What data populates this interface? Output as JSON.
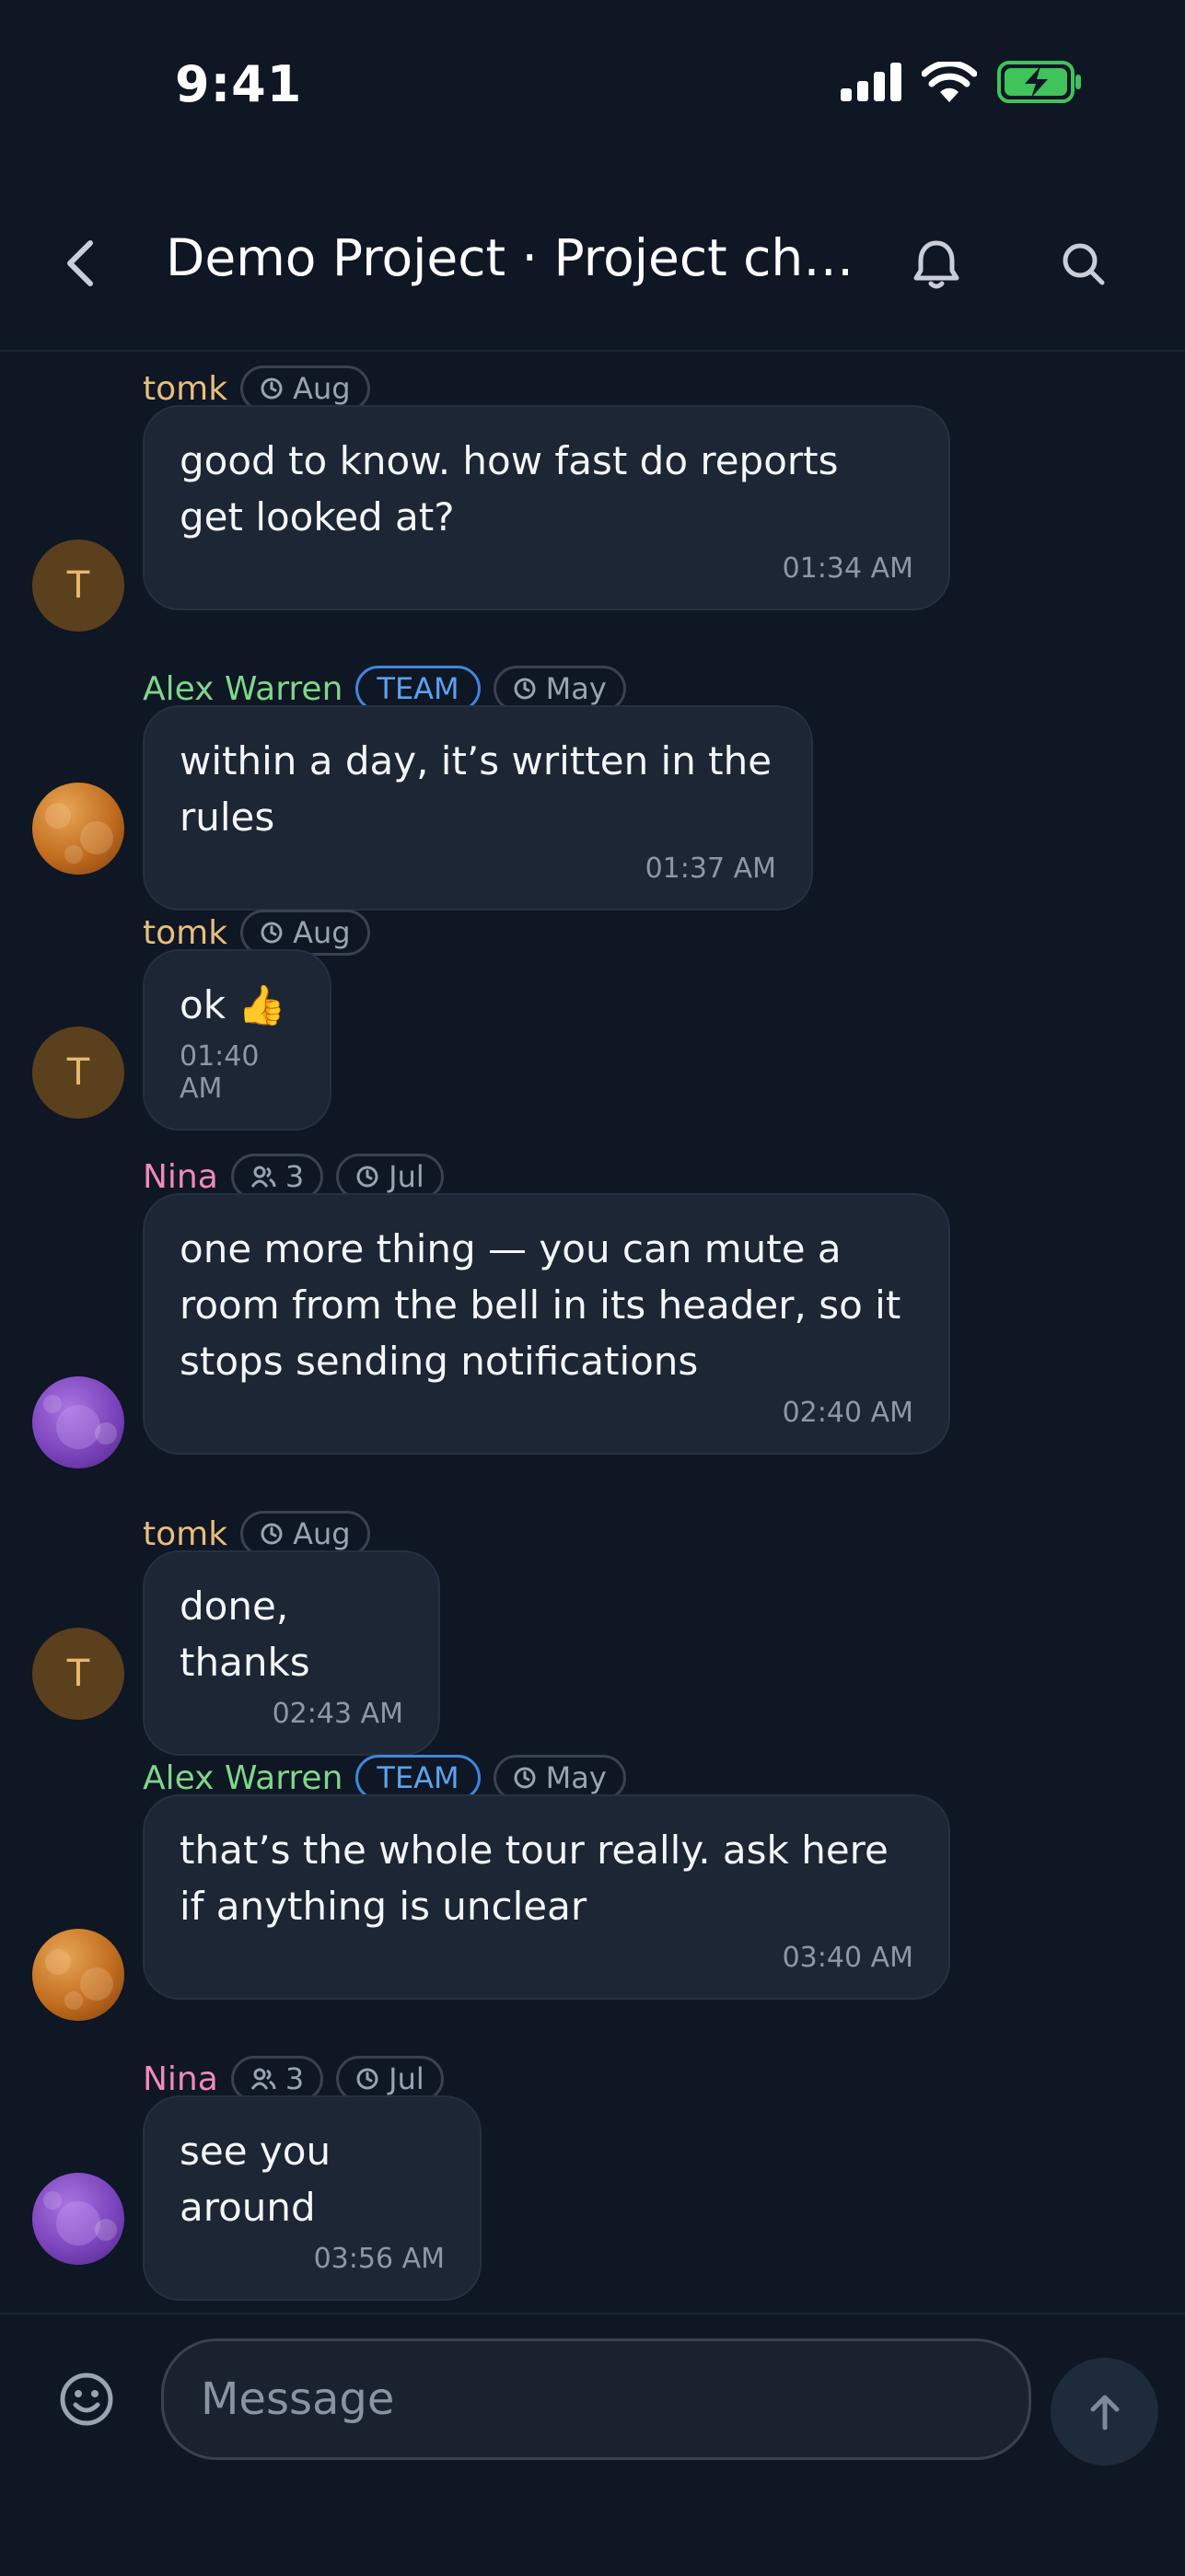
{
  "status_bar": {
    "time": "9:41"
  },
  "header": {
    "title": "Demo Project · Project cha..."
  },
  "composer": {
    "placeholder": "Message"
  },
  "messages": [
    {
      "author": "tomk",
      "author_color": "#e9bd7c",
      "avatar_letter": "T",
      "time_chip": "Aug",
      "text": "good to know. how fast do reports get looked at?",
      "time": "01:34 AM"
    },
    {
      "author": "Alex Warren",
      "author_color": "#7fd689",
      "badge": "TEAM",
      "time_chip": "May",
      "text": "within a day, it’s written in the rules",
      "time": "01:37 AM"
    },
    {
      "author": "tomk",
      "author_color": "#e9bd7c",
      "avatar_letter": "T",
      "time_chip": "Aug",
      "text": "ok 👍",
      "time": "01:40 AM"
    },
    {
      "author": "Nina",
      "author_color": "#f08ab8",
      "member_count": "3",
      "time_chip": "Jul",
      "text": "one more thing — you can mute a room from the bell in its header, so it stops sending notifications",
      "time": "02:40 AM"
    },
    {
      "author": "tomk",
      "author_color": "#e9bd7c",
      "avatar_letter": "T",
      "time_chip": "Aug",
      "text": "done, thanks",
      "time": "02:43 AM"
    },
    {
      "author": "Alex Warren",
      "author_color": "#7fd689",
      "badge": "TEAM",
      "time_chip": "May",
      "text": "that’s the whole tour really. ask here if anything is unclear",
      "time": "03:40 AM"
    },
    {
      "author": "Nina",
      "author_color": "#f08ab8",
      "member_count": "3",
      "time_chip": "Jul",
      "text": "see you around",
      "time": "03:56 AM"
    }
  ]
}
